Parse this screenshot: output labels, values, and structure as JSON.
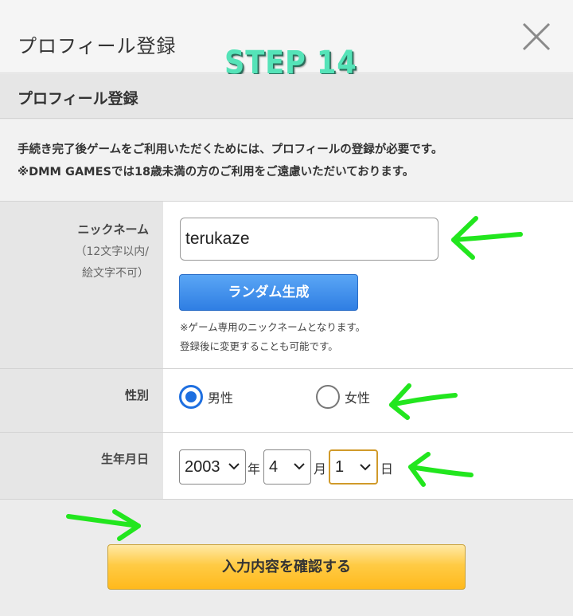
{
  "header": {
    "title": "プロフィール登録"
  },
  "overlay": {
    "step_text": "STEP 14"
  },
  "section": {
    "title": "プロフィール登録"
  },
  "notice": {
    "line1": "手続き完了後ゲームをご利用いただくためには、プロフィールの登録が必要です。",
    "line2": "※DMM GAMESでは18歳未満の方のご利用をご遠慮いただいております。"
  },
  "nickname": {
    "label": "ニックネーム",
    "sub1": "（12文字以内/",
    "sub2": "絵文字不可）",
    "value": "terukaze",
    "random_button": "ランダム生成",
    "note1": "※ゲーム専用のニックネームとなります。",
    "note2": "登録後に変更することも可能です。"
  },
  "gender": {
    "label": "性別",
    "options": [
      {
        "label": "男性",
        "selected": true
      },
      {
        "label": "女性",
        "selected": false
      }
    ]
  },
  "birthday": {
    "label": "生年月日",
    "year": "2003",
    "year_unit": "年",
    "month": "4",
    "month_unit": "月",
    "day": "1",
    "day_unit": "日"
  },
  "confirm_button": "入力内容を確認する",
  "colors": {
    "annotation_arrow": "#22e61e",
    "random_button": "#2f7ee3",
    "confirm_button": "#ffc12e",
    "radio_selected": "#1e6fe0",
    "step_text": "#55e3b8"
  }
}
